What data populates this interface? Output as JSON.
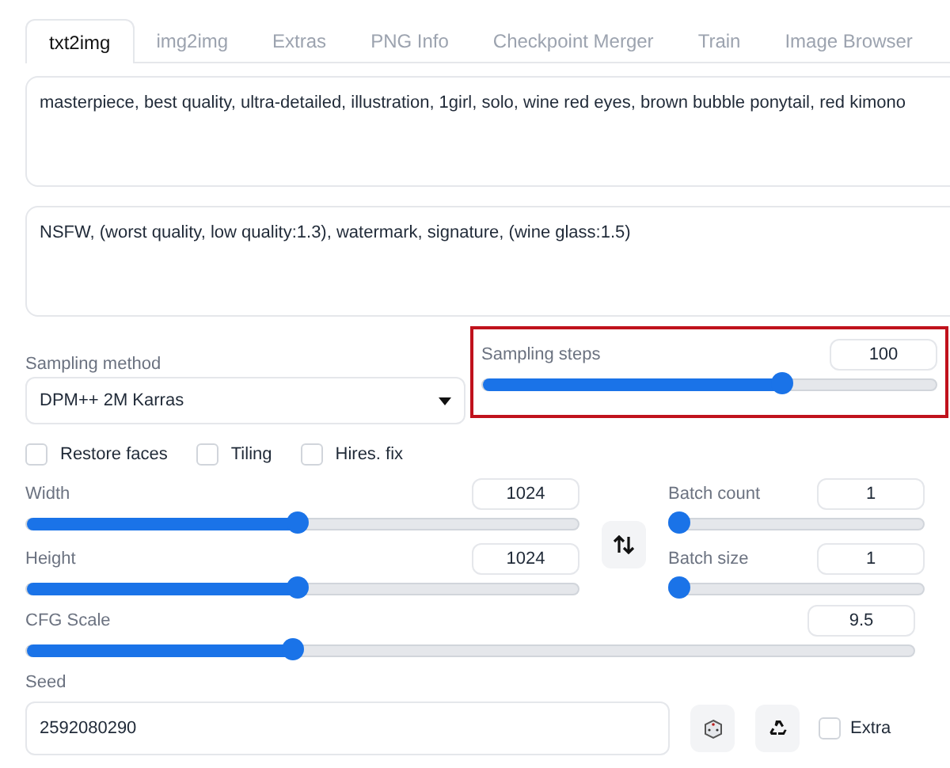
{
  "tabs": [
    {
      "label": "txt2img",
      "selected": true
    },
    {
      "label": "img2img",
      "selected": false
    },
    {
      "label": "Extras",
      "selected": false
    },
    {
      "label": "PNG Info",
      "selected": false
    },
    {
      "label": "Checkpoint Merger",
      "selected": false
    },
    {
      "label": "Train",
      "selected": false
    },
    {
      "label": "Image Browser",
      "selected": false
    }
  ],
  "prompt": {
    "value": "masterpiece, best quality, ultra-detailed, illustration, 1girl, solo, wine red eyes, brown bubble ponytail,  red kimono"
  },
  "negative_prompt": {
    "value": "NSFW, (worst quality, low quality:1.3), watermark, signature, (wine glass:1.5)"
  },
  "sampling_method": {
    "label": "Sampling method",
    "value": "DPM++ 2M Karras"
  },
  "sampling_steps": {
    "label": "Sampling steps",
    "value": "100",
    "level": 0.66,
    "highlighted": true
  },
  "options": [
    {
      "label": "Restore faces",
      "checked": false
    },
    {
      "label": "Tiling",
      "checked": false
    },
    {
      "label": "Hires. fix",
      "checked": false
    }
  ],
  "width": {
    "label": "Width",
    "value": "1024",
    "level": 0.49
  },
  "height": {
    "label": "Height",
    "value": "1024",
    "level": 0.49
  },
  "batch_count": {
    "label": "Batch count",
    "value": "1",
    "level": 0
  },
  "batch_size": {
    "label": "Batch size",
    "value": "1",
    "level": 0
  },
  "cfg_scale": {
    "label": "CFG Scale",
    "value": "9.5",
    "level": 0.3
  },
  "seed": {
    "label": "Seed",
    "value": "2592080290"
  },
  "extra": {
    "label": "Extra",
    "checked": false
  }
}
